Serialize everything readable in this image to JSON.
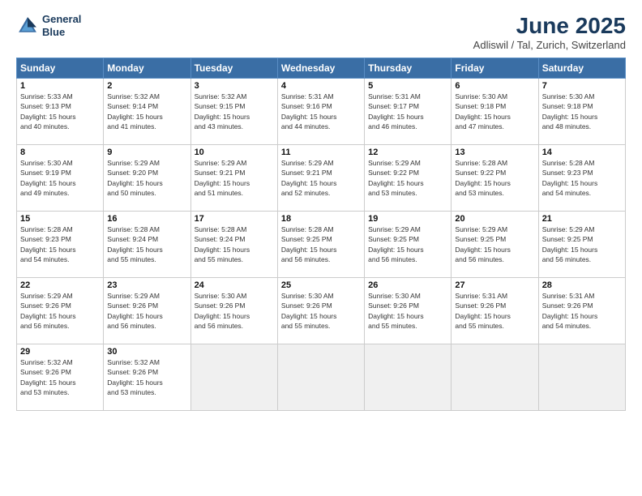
{
  "header": {
    "logo_line1": "General",
    "logo_line2": "Blue",
    "title": "June 2025",
    "subtitle": "Adliswil / Tal, Zurich, Switzerland"
  },
  "weekdays": [
    "Sunday",
    "Monday",
    "Tuesday",
    "Wednesday",
    "Thursday",
    "Friday",
    "Saturday"
  ],
  "weeks": [
    [
      {
        "day": "1",
        "info": "Sunrise: 5:33 AM\nSunset: 9:13 PM\nDaylight: 15 hours\nand 40 minutes."
      },
      {
        "day": "2",
        "info": "Sunrise: 5:32 AM\nSunset: 9:14 PM\nDaylight: 15 hours\nand 41 minutes."
      },
      {
        "day": "3",
        "info": "Sunrise: 5:32 AM\nSunset: 9:15 PM\nDaylight: 15 hours\nand 43 minutes."
      },
      {
        "day": "4",
        "info": "Sunrise: 5:31 AM\nSunset: 9:16 PM\nDaylight: 15 hours\nand 44 minutes."
      },
      {
        "day": "5",
        "info": "Sunrise: 5:31 AM\nSunset: 9:17 PM\nDaylight: 15 hours\nand 46 minutes."
      },
      {
        "day": "6",
        "info": "Sunrise: 5:30 AM\nSunset: 9:18 PM\nDaylight: 15 hours\nand 47 minutes."
      },
      {
        "day": "7",
        "info": "Sunrise: 5:30 AM\nSunset: 9:18 PM\nDaylight: 15 hours\nand 48 minutes."
      }
    ],
    [
      {
        "day": "8",
        "info": "Sunrise: 5:30 AM\nSunset: 9:19 PM\nDaylight: 15 hours\nand 49 minutes."
      },
      {
        "day": "9",
        "info": "Sunrise: 5:29 AM\nSunset: 9:20 PM\nDaylight: 15 hours\nand 50 minutes."
      },
      {
        "day": "10",
        "info": "Sunrise: 5:29 AM\nSunset: 9:21 PM\nDaylight: 15 hours\nand 51 minutes."
      },
      {
        "day": "11",
        "info": "Sunrise: 5:29 AM\nSunset: 9:21 PM\nDaylight: 15 hours\nand 52 minutes."
      },
      {
        "day": "12",
        "info": "Sunrise: 5:29 AM\nSunset: 9:22 PM\nDaylight: 15 hours\nand 53 minutes."
      },
      {
        "day": "13",
        "info": "Sunrise: 5:28 AM\nSunset: 9:22 PM\nDaylight: 15 hours\nand 53 minutes."
      },
      {
        "day": "14",
        "info": "Sunrise: 5:28 AM\nSunset: 9:23 PM\nDaylight: 15 hours\nand 54 minutes."
      }
    ],
    [
      {
        "day": "15",
        "info": "Sunrise: 5:28 AM\nSunset: 9:23 PM\nDaylight: 15 hours\nand 54 minutes."
      },
      {
        "day": "16",
        "info": "Sunrise: 5:28 AM\nSunset: 9:24 PM\nDaylight: 15 hours\nand 55 minutes."
      },
      {
        "day": "17",
        "info": "Sunrise: 5:28 AM\nSunset: 9:24 PM\nDaylight: 15 hours\nand 55 minutes."
      },
      {
        "day": "18",
        "info": "Sunrise: 5:28 AM\nSunset: 9:25 PM\nDaylight: 15 hours\nand 56 minutes."
      },
      {
        "day": "19",
        "info": "Sunrise: 5:29 AM\nSunset: 9:25 PM\nDaylight: 15 hours\nand 56 minutes."
      },
      {
        "day": "20",
        "info": "Sunrise: 5:29 AM\nSunset: 9:25 PM\nDaylight: 15 hours\nand 56 minutes."
      },
      {
        "day": "21",
        "info": "Sunrise: 5:29 AM\nSunset: 9:25 PM\nDaylight: 15 hours\nand 56 minutes."
      }
    ],
    [
      {
        "day": "22",
        "info": "Sunrise: 5:29 AM\nSunset: 9:26 PM\nDaylight: 15 hours\nand 56 minutes."
      },
      {
        "day": "23",
        "info": "Sunrise: 5:29 AM\nSunset: 9:26 PM\nDaylight: 15 hours\nand 56 minutes."
      },
      {
        "day": "24",
        "info": "Sunrise: 5:30 AM\nSunset: 9:26 PM\nDaylight: 15 hours\nand 56 minutes."
      },
      {
        "day": "25",
        "info": "Sunrise: 5:30 AM\nSunset: 9:26 PM\nDaylight: 15 hours\nand 55 minutes."
      },
      {
        "day": "26",
        "info": "Sunrise: 5:30 AM\nSunset: 9:26 PM\nDaylight: 15 hours\nand 55 minutes."
      },
      {
        "day": "27",
        "info": "Sunrise: 5:31 AM\nSunset: 9:26 PM\nDaylight: 15 hours\nand 55 minutes."
      },
      {
        "day": "28",
        "info": "Sunrise: 5:31 AM\nSunset: 9:26 PM\nDaylight: 15 hours\nand 54 minutes."
      }
    ],
    [
      {
        "day": "29",
        "info": "Sunrise: 5:32 AM\nSunset: 9:26 PM\nDaylight: 15 hours\nand 53 minutes."
      },
      {
        "day": "30",
        "info": "Sunrise: 5:32 AM\nSunset: 9:26 PM\nDaylight: 15 hours\nand 53 minutes."
      },
      {
        "day": "",
        "info": ""
      },
      {
        "day": "",
        "info": ""
      },
      {
        "day": "",
        "info": ""
      },
      {
        "day": "",
        "info": ""
      },
      {
        "day": "",
        "info": ""
      }
    ]
  ]
}
